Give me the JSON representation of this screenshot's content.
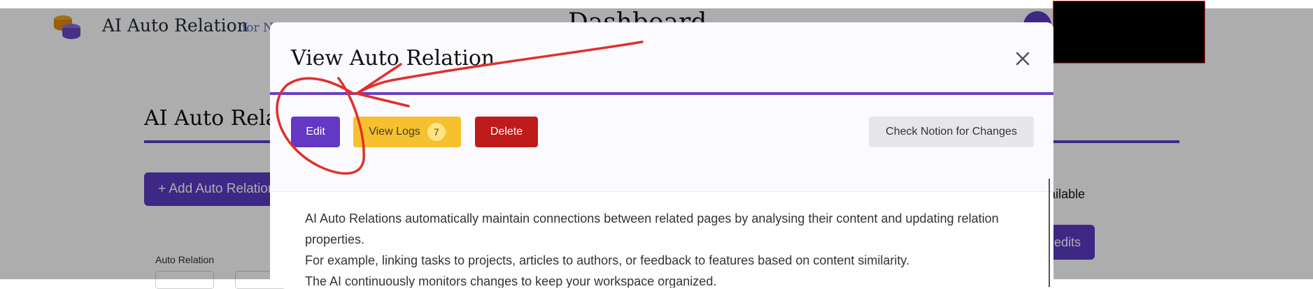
{
  "app": {
    "brand_name": "AI Auto Relation",
    "brand_suffix": "for N",
    "page_title": "Dashboard"
  },
  "background": {
    "section_heading": "AI Auto Rela",
    "add_button_label": "+ Add Auto Relation",
    "credits_available_text": "vailable",
    "credits_button_label": "edits",
    "filter_label": "Auto Relation"
  },
  "modal": {
    "title": "View Auto Relation",
    "actions": {
      "edit_label": "Edit",
      "view_logs_label": "View Logs",
      "logs_count": "7",
      "delete_label": "Delete",
      "check_label": "Check Notion for Changes"
    },
    "description": [
      "AI Auto Relations automatically maintain connections between related pages by analysing their content and updating relation properties.",
      "For example, linking tasks to projects, articles to authors, or feedback to features based on content similarity.",
      "The AI continuously monitors changes to keep your workspace organized."
    ]
  },
  "colors": {
    "primary": "#6238c4",
    "warning": "#f6c12f",
    "danger": "#c01b1b",
    "neutral_button": "#e7e7ea",
    "annotation": "#e0302b",
    "redaction": "#000000"
  },
  "icons": {
    "close": "close-icon",
    "logo": "database-coins-icon"
  }
}
